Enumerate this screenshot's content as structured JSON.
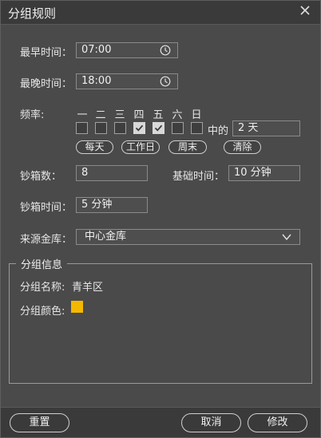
{
  "dialog": {
    "title": "分组规则"
  },
  "form": {
    "earliest_label": "最早时间：",
    "earliest_value": "07:00",
    "latest_label": "最晚时间：",
    "latest_value": "18:00",
    "frequency_label": "频率:",
    "weekdays": [
      {
        "label": "一",
        "checked": false
      },
      {
        "label": "二",
        "checked": false
      },
      {
        "label": "三",
        "checked": false
      },
      {
        "label": "四",
        "checked": true
      },
      {
        "label": "五",
        "checked": true
      },
      {
        "label": "六",
        "checked": false
      },
      {
        "label": "日",
        "checked": false
      }
    ],
    "among_label": "中的",
    "among_value": "2 天",
    "quick_buttons": [
      "每天",
      "工作日",
      "周末",
      "清除"
    ],
    "cashbox_count_label": "钞箱数：",
    "cashbox_count_value": "8",
    "base_time_label": "基础时间：",
    "base_time_value": "10 分钟",
    "cashbox_time_label": "钞箱时间：",
    "cashbox_time_value": "5 分钟",
    "source_vault_label": "来源金库：",
    "source_vault_value": "中心金库"
  },
  "group_info": {
    "legend": "分组信息",
    "name_label": "分组名称:",
    "name_value": "青羊区",
    "color_label": "分组颜色:",
    "color_value": "#f5b800"
  },
  "footer": {
    "reset_label": "重置",
    "cancel_label": "取消",
    "modify_label": "修改"
  },
  "icons": {
    "close": "close-icon",
    "clock": "clock-icon",
    "dropdown": "chevron-down-icon",
    "check": "check-icon"
  }
}
